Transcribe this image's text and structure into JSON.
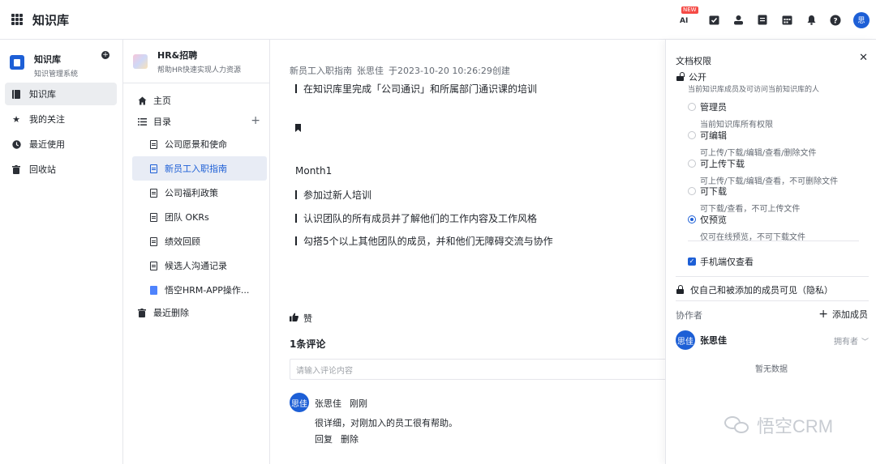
{
  "topbar": {
    "app_title": "知识库",
    "new_badge": "NEW",
    "ai_label": "AI",
    "user_avatar": "思"
  },
  "sidebar": {
    "kb_name": "知识库",
    "kb_desc": "知识管理系统",
    "items": [
      {
        "label": "知识库",
        "icon": "book-icon",
        "active": true
      },
      {
        "label": "我的关注",
        "icon": "star-icon"
      },
      {
        "label": "最近使用",
        "icon": "clock-icon"
      },
      {
        "label": "回收站",
        "icon": "trash-icon"
      }
    ]
  },
  "directory": {
    "space_name": "HR&招聘",
    "space_desc": "帮助HR快速实现人力资源",
    "home_label": "主页",
    "toc_label": "目录",
    "docs": [
      {
        "label": "公司愿景和使命"
      },
      {
        "label": "新员工入职指南",
        "active": true
      },
      {
        "label": "公司福利政策"
      },
      {
        "label": "团队 OKRs"
      },
      {
        "label": "绩效回顾"
      },
      {
        "label": "候选人沟通记录"
      },
      {
        "label": "悟空HRM-APP操作..."
      }
    ],
    "deleted_label": "最近删除"
  },
  "document": {
    "meta_title": "新员工入职指南",
    "meta_author": "张思佳",
    "meta_created": "于2023-10-20 10:26:29创建",
    "line1": "在知识库里完成「公司通识」和所属部门通识课的培训",
    "month": "Month1",
    "line2": "参加过新人培训",
    "line3": "认识团队的所有成员并了解他们的工作内容及工作风格",
    "line4": "勾搭5个以上其他团队的成员，并和他们无障碍交流与协作",
    "like_label": "赞",
    "comment_count": "1条评论",
    "comment_placeholder": "请输入评论内容",
    "comment": {
      "avatar": "思佳",
      "author": "张思佳",
      "time": "刚刚",
      "body": "很详细，对刚加入的员工很有帮助。",
      "reply": "回复",
      "delete": "删除"
    }
  },
  "permissions": {
    "title": "文档权限",
    "public_label": "公开",
    "public_desc": "当前知识库成员及可访问当前知识库的人",
    "options": [
      {
        "label": "管理员",
        "desc": "当前知识库所有权限",
        "selected": false
      },
      {
        "label": "可编辑",
        "desc": "可上传/下载/编辑/查看/删除文件",
        "selected": false
      },
      {
        "label": "可上传下载",
        "desc": "可上传/下载/编辑/查看，不可删除文件",
        "selected": false
      },
      {
        "label": "可下载",
        "desc": "可下载/查看，不可上传文件",
        "selected": false
      },
      {
        "label": "仅预览",
        "desc": "仅可在线预览，不可下载文件",
        "selected": true
      }
    ],
    "mobile_only": "手机端仅查看",
    "private_label": "仅自己和被添加的成员可见（隐私）",
    "collaborators_label": "协作者",
    "add_member": "添加成员",
    "member": {
      "avatar": "思佳",
      "name": "张思佳",
      "role": "拥有者"
    },
    "empty": "暂无数据"
  },
  "watermark": "悟空CRM",
  "colors": {
    "accent": "#1d5fd6",
    "border": "#e5e6eb",
    "muted": "#646a73"
  }
}
